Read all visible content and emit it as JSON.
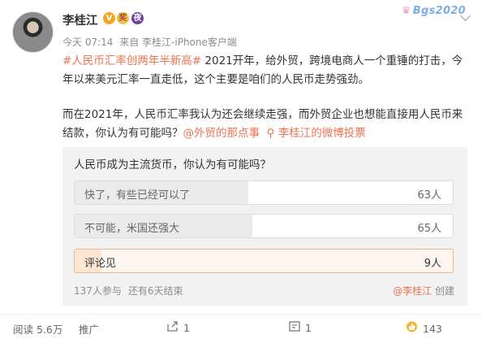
{
  "post": {
    "author": "李桂江",
    "badges": {
      "verified": "V",
      "medal": "奖",
      "member": "夜"
    },
    "brand_deco": {
      "text": "Bgs2020",
      "crown": "♛",
      "close": "×"
    },
    "time": "今天 07:14",
    "source": "来自 李桂江-iPhone客户端",
    "content": {
      "p1_topic": "#人民币汇率创两年半新高#",
      "p1_text": " 2021开年，给外贸，跨境电商人一个重锤的打击，今年以来美元汇率一直走低，这个主要是咱们的人民币走势强劲。",
      "p2_text": "而在2021年，人民币汇率我认为还会继续走强，而外贸企业也想能直接用人民币来结款，你认为有可能吗？",
      "p2_mention": "@外贸的那点事",
      "p2_poll_icon": "⚲",
      "p2_poll_link": "李桂江的微博投票"
    }
  },
  "poll": {
    "question": "人民币成为主流货币，你认为有可能吗？",
    "options": [
      {
        "label": "快了，有些已经可以了",
        "count": "63人",
        "share": 0.46
      },
      {
        "label": "不可能，米国还强大",
        "count": "65人",
        "share": 0.47
      },
      {
        "label": "评论见",
        "count": "9人",
        "share": 0.07,
        "selected": true
      }
    ],
    "participants": "137人参与",
    "remaining": "还有6天结束",
    "creator_mention": "@李桂江",
    "creator_suffix": "创建"
  },
  "actions": {
    "reads": "阅读 5.6万",
    "promote": "推广",
    "share_count": "1",
    "comment_count": "1",
    "like_count": "143"
  }
}
